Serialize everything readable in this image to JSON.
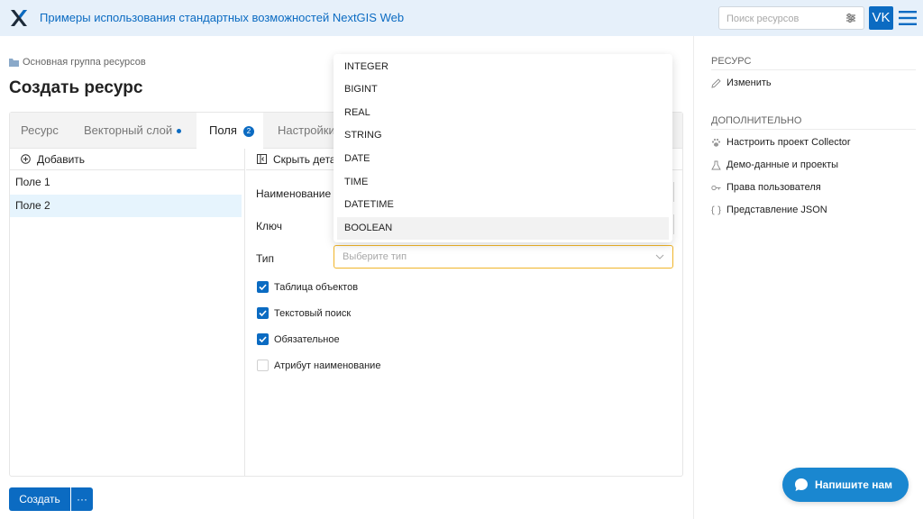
{
  "header": {
    "app_title": "Примеры использования стандартных возможностей NextGIS Web",
    "search_placeholder": "Поиск ресурсов",
    "avatar_initials": "VK"
  },
  "breadcrumb": "Основная группа ресурсов",
  "page_title": "Создать ресурс",
  "tabs": [
    {
      "label": "Ресурс"
    },
    {
      "label": "Векторный слой"
    },
    {
      "label": "Поля",
      "count": "2"
    },
    {
      "label": "Настройки"
    }
  ],
  "fields": {
    "add_label": "Добавить",
    "items": [
      "Поле 1",
      "Поле 2"
    ]
  },
  "details": {
    "hide_label": "Скрыть детали",
    "name_label": "Наименование",
    "key_label": "Ключ",
    "type_label": "Тип",
    "type_placeholder": "Выберите тип",
    "checkboxes": [
      {
        "label": "Таблица объектов",
        "checked": true
      },
      {
        "label": "Текстовый поиск",
        "checked": true
      },
      {
        "label": "Обязательное",
        "checked": true
      },
      {
        "label": "Атрибут наименование",
        "checked": false
      }
    ]
  },
  "type_options": [
    "INTEGER",
    "BIGINT",
    "REAL",
    "STRING",
    "DATE",
    "TIME",
    "DATETIME",
    "BOOLEAN"
  ],
  "sidebar": {
    "resource_heading": "РЕСУРС",
    "edit_label": "Изменить",
    "extra_heading": "ДОПОЛНИТЕЛЬНО",
    "items": [
      "Настроить проект Collector",
      "Демо-данные и проекты",
      "Права пользователя",
      "Представление JSON"
    ]
  },
  "buttons": {
    "create": "Создать",
    "more": "···",
    "chat": "Напишите нам"
  },
  "colors": {
    "accent": "#0b6bc2",
    "header_bg": "#e6f0fa",
    "select_border": "#f0b429"
  }
}
